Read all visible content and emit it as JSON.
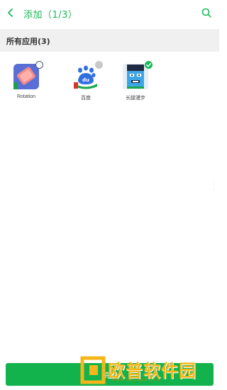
{
  "header": {
    "title": "添加（1/3）",
    "back_icon": "chevron-left-icon",
    "search_icon": "search-icon"
  },
  "section": {
    "title": "所有应用(3)"
  },
  "apps": [
    {
      "label": "Rotation",
      "icon": "rotation-app-icon",
      "selected": false
    },
    {
      "label": "百度",
      "icon": "baidu-app-icon",
      "selected": false
    },
    {
      "label": "长腿漫步",
      "icon": "long-legs-game-icon",
      "selected": true
    }
  ],
  "bottom": {
    "label": "完成"
  },
  "watermark": {
    "name": "欧普软件园",
    "url": "www.opoujin.com"
  },
  "colors": {
    "accent": "#19b95a",
    "bar": "#12b34d",
    "section_bg": "#f0f0f0"
  }
}
